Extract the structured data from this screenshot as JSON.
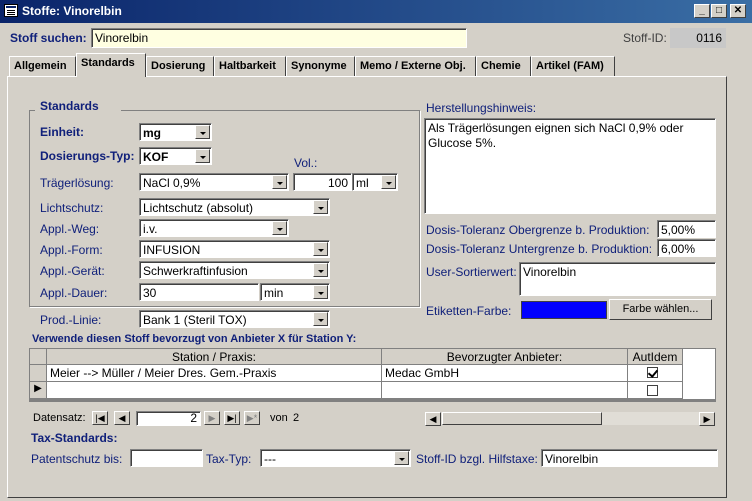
{
  "window": {
    "title": "Stoffe: Vinorelbin"
  },
  "search": {
    "label": "Stoff suchen:",
    "value": "Vinorelbin",
    "id_label": "Stoff-ID:",
    "id_value": "0116"
  },
  "tabs": [
    "Allgemein",
    "Standards",
    "Dosierung",
    "Haltbarkeit",
    "Synonyme",
    "Memo / Externe Obj.",
    "Chemie",
    "Artikel (FAM)"
  ],
  "active_tab": "Standards",
  "standards": {
    "group_title": "Standards",
    "einheit": {
      "label": "Einheit:",
      "value": "mg"
    },
    "dosierungs_typ": {
      "label": "Dosierungs-Typ:",
      "value": "KOF"
    },
    "vol_label": "Vol.:",
    "traegerloesung": {
      "label": "Trägerlösung:",
      "value": "NaCl 0,9%",
      "vol": "100",
      "unit": "ml"
    },
    "lichtschutz": {
      "label": "Lichtschutz:",
      "value": "Lichtschutz (absolut)"
    },
    "appl_weg": {
      "label": "Appl.-Weg:",
      "value": "i.v."
    },
    "appl_form": {
      "label": "Appl.-Form:",
      "value": "INFUSION"
    },
    "appl_geraet": {
      "label": "Appl.-Gerät:",
      "value": "Schwerkraftinfusion"
    },
    "appl_dauer": {
      "label": "Appl.-Dauer:",
      "value": "30",
      "unit": "min"
    },
    "prod_linie": {
      "label": "Prod.-Linie:",
      "value": "Bank 1 (Steril TOX)"
    }
  },
  "herstellung": {
    "label": "Herstellungshinweis:",
    "text": "Als Trägerlösungen eignen sich NaCl 0,9% oder Glucose 5%."
  },
  "toleranz": {
    "ober_label": "Dosis-Toleranz Obergrenze b. Produktion:",
    "ober_value": "5,00%",
    "unter_label": "Dosis-Toleranz Untergrenze b. Produktion:",
    "unter_value": "6,00%"
  },
  "user_sort": {
    "label": "User-Sortierwert:",
    "value": "Vinorelbin"
  },
  "etikett": {
    "label": "Etiketten-Farbe:",
    "color": "#0000ff",
    "button": "Farbe wählen..."
  },
  "anbieter": {
    "title": "Verwende diesen Stoff bevorzugt von Anbieter X für Station Y:",
    "columns": [
      "Station / Praxis:",
      "Bevorzugter Anbieter:",
      "AutIdem"
    ],
    "rows": [
      {
        "station": "Meier --> Müller / Meier Dres. Gem.-Praxis",
        "anbieter": "Medac GmbH",
        "autidem": true
      },
      {
        "station": "",
        "anbieter": "",
        "autidem": false
      }
    ]
  },
  "nav": {
    "label": "Datensatz:",
    "current": "2",
    "of_label": "von",
    "total": "2"
  },
  "tax": {
    "title": "Tax-Standards:",
    "patent_label": "Patentschutz bis:",
    "patent_value": "",
    "typ_label": "Tax-Typ:",
    "typ_value": "---",
    "hilfstaxe_label": "Stoff-ID bzgl. Hilfstaxe:",
    "hilfstaxe_value": "Vinorelbin"
  }
}
